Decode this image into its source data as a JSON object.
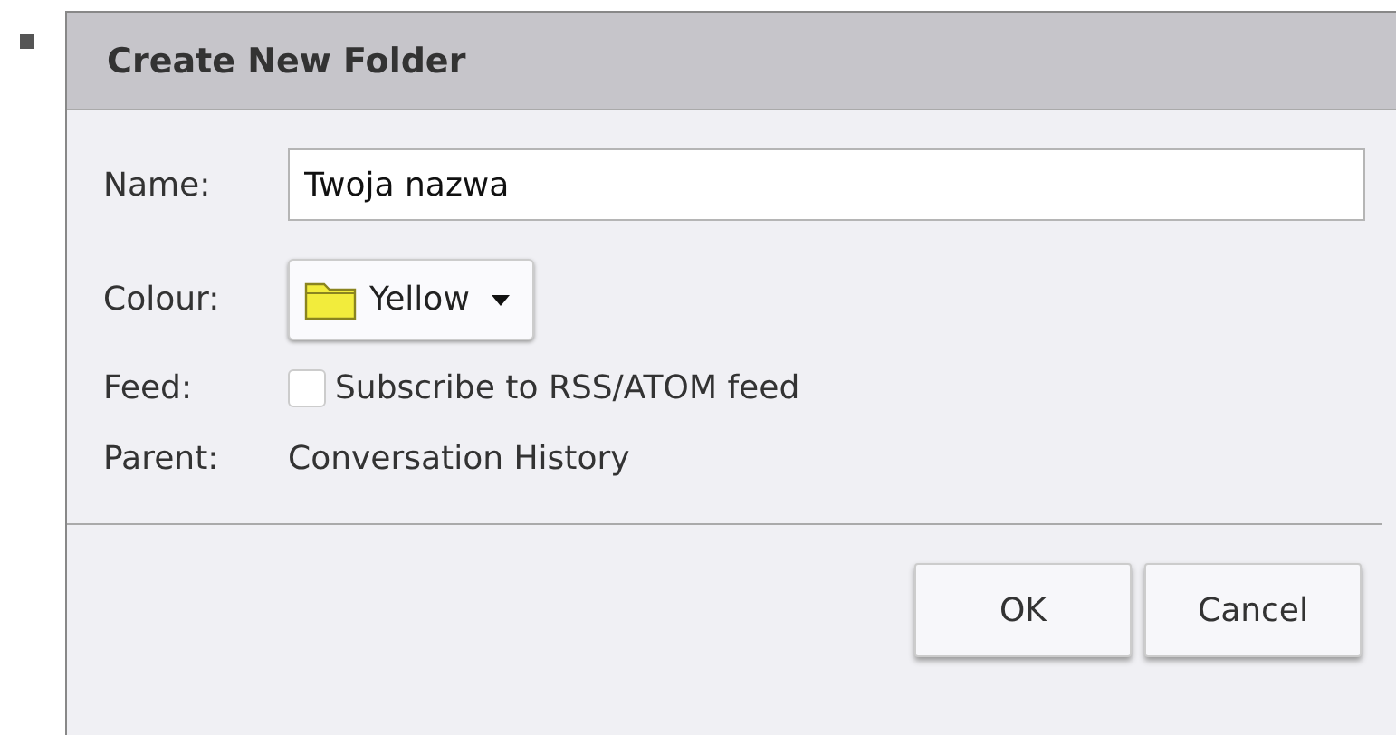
{
  "dialog": {
    "title": "Create New Folder",
    "name": {
      "label": "Name:",
      "value": "Twoja nazwa"
    },
    "colour": {
      "label": "Colour:",
      "value": "Yellow",
      "color": "#f2ec3c"
    },
    "feed": {
      "label": "Feed:",
      "option": "Subscribe to RSS/ATOM feed",
      "checked": false
    },
    "parent": {
      "label": "Parent:",
      "value": "Conversation History"
    },
    "buttons": [
      "OK",
      "Cancel"
    ]
  }
}
